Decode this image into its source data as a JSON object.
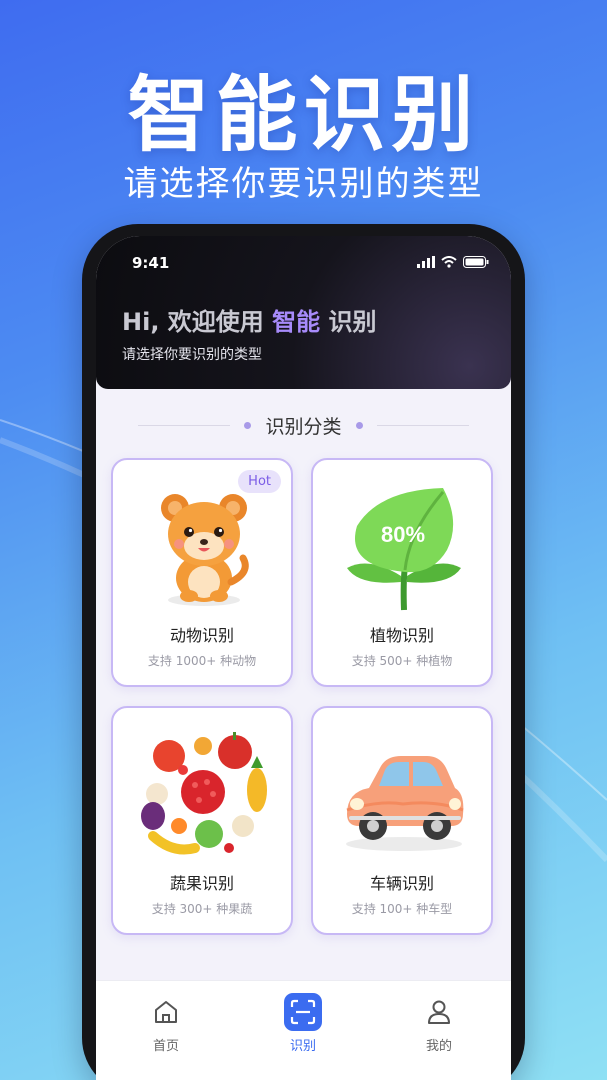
{
  "promo": {
    "title": "智能识别",
    "subtitle": "请选择你要识别的类型"
  },
  "status_bar": {
    "time": "9:41"
  },
  "header": {
    "greeting_prefix": "Hi, 欢迎使用",
    "greeting_highlight": "智能",
    "greeting_suffix": "识别",
    "subtitle": "请选择你要识别的类型"
  },
  "section": {
    "title": "识别分类"
  },
  "categories": [
    {
      "title": "动物识别",
      "desc": "支持 1000+ 种动物",
      "badge": "Hot",
      "icon": "puppy-icon"
    },
    {
      "title": "植物识别",
      "desc": "支持 500+ 种植物",
      "badge_overlay": "80%",
      "icon": "leaf-icon"
    },
    {
      "title": "蔬果识别",
      "desc": "支持 300+ 种果蔬",
      "icon": "fruits-icon"
    },
    {
      "title": "车辆识别",
      "desc": "支持 100+ 种车型",
      "icon": "car-icon"
    }
  ],
  "tabbar": {
    "items": [
      {
        "label": "首页",
        "icon": "home-icon"
      },
      {
        "label": "识别",
        "icon": "scan-icon",
        "active": true
      },
      {
        "label": "我的",
        "icon": "user-icon"
      }
    ]
  },
  "colors": {
    "accent": "#3b6cf0",
    "highlight": "#a78bfa",
    "card_border": "#c7b8f5"
  }
}
